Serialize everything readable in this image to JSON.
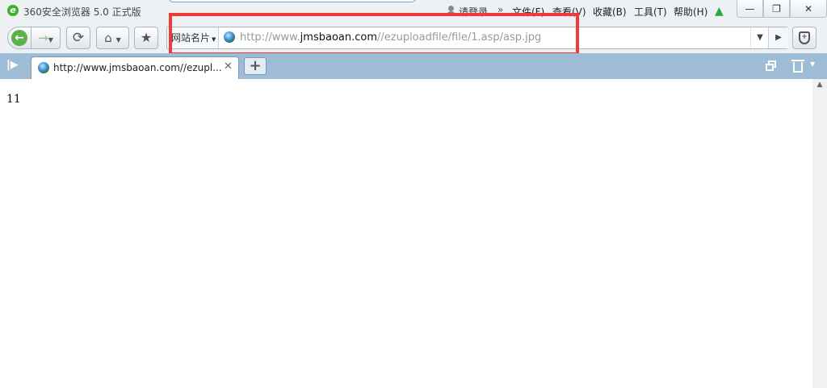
{
  "window": {
    "title": "360安全浏览器 5.0 正式版",
    "login_label": "请登录",
    "more_label": "»",
    "menus": [
      "文件(F)",
      "查看(V)",
      "收藏(B)",
      "工具(T)",
      "帮助(H)"
    ],
    "min_label": "—",
    "restore_label": "❐",
    "close_label": "✕"
  },
  "toolbar": {
    "back_label": "←",
    "forward_label": "→",
    "refresh_label": "⟳",
    "home_label": "⌂",
    "favorite_label": "★",
    "site_card_label": "网站名片",
    "url_prefix": "http://www.",
    "url_domain": "jmsbaoan.com",
    "url_path": "//ezuploadfile/file/1.asp/asp.jpg",
    "dropdown_label": "▼",
    "go_label": "▶",
    "shield_label": "+"
  },
  "tabs": [
    {
      "title": "http://www.jmsbaoan.com//ezupl...",
      "close_label": "✕"
    }
  ],
  "tabbar": {
    "sidebar_toggle_label": "|▶",
    "new_tab_label": "+",
    "trash_dropdown_label": "▼"
  },
  "page": {
    "body_text": "11"
  },
  "scrollbar": {
    "up_label": "▲"
  },
  "colors": {
    "tabbar_bg": "#9ebcd5",
    "toolbar_bg": "#eef1f4",
    "annotation_red": "#f03b3b",
    "back_green": "#5bb24a"
  }
}
